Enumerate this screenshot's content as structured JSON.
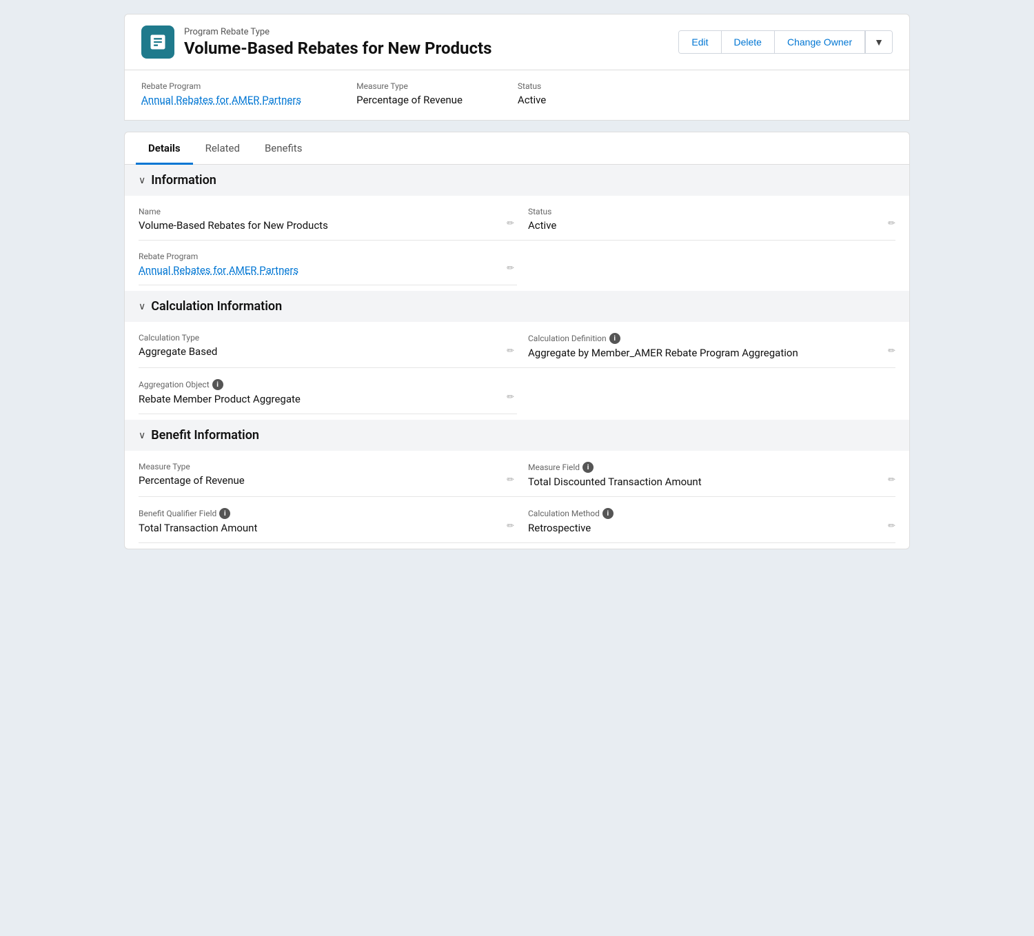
{
  "header": {
    "subtitle": "Program Rebate Type",
    "title": "Volume-Based Rebates for New Products",
    "buttons": {
      "edit": "Edit",
      "delete": "Delete",
      "change_owner": "Change Owner"
    }
  },
  "info_strip": {
    "rebate_program_label": "Rebate Program",
    "rebate_program_value": "Annual Rebates for AMER Partners",
    "measure_type_label": "Measure Type",
    "measure_type_value": "Percentage of Revenue",
    "status_label": "Status",
    "status_value": "Active"
  },
  "tabs": {
    "active": "Details",
    "items": [
      "Details",
      "Related",
      "Benefits"
    ]
  },
  "sections": {
    "information": {
      "title": "Information",
      "fields": {
        "name_label": "Name",
        "name_value": "Volume-Based Rebates for New Products",
        "status_label": "Status",
        "status_value": "Active",
        "rebate_program_label": "Rebate Program",
        "rebate_program_value": "Annual Rebates for AMER Partners"
      }
    },
    "calculation": {
      "title": "Calculation Information",
      "fields": {
        "calc_type_label": "Calculation Type",
        "calc_type_value": "Aggregate Based",
        "calc_def_label": "Calculation Definition",
        "calc_def_value": "Aggregate by Member_AMER Rebate Program Aggregation",
        "agg_object_label": "Aggregation Object",
        "agg_object_value": "Rebate Member Product Aggregate"
      }
    },
    "benefit": {
      "title": "Benefit Information",
      "fields": {
        "measure_type_label": "Measure Type",
        "measure_type_value": "Percentage of Revenue",
        "measure_field_label": "Measure Field",
        "measure_field_value": "Total Discounted Transaction Amount",
        "benefit_qualifier_label": "Benefit Qualifier Field",
        "benefit_qualifier_value": "Total Transaction Amount",
        "calc_method_label": "Calculation Method",
        "calc_method_value": "Retrospective"
      }
    }
  }
}
